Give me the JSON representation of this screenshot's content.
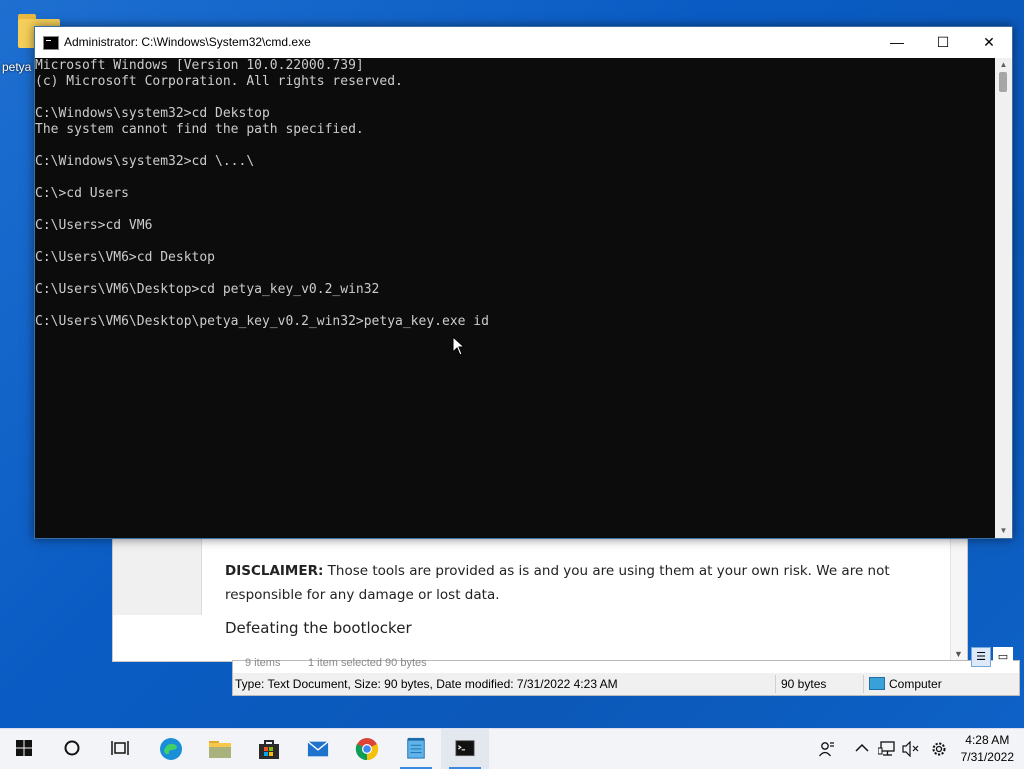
{
  "desktop": {
    "icon_label": "petya"
  },
  "cmd_window": {
    "title": "Administrator: C:\\Windows\\System32\\cmd.exe",
    "minimize": "—",
    "maximize": "☐",
    "close": "✕",
    "lines": [
      "Microsoft Windows [Version 10.0.22000.739]",
      "(c) Microsoft Corporation. All rights reserved.",
      "",
      "C:\\Windows\\system32>cd Dekstop",
      "The system cannot find the path specified.",
      "",
      "C:\\Windows\\system32>cd \\...\\",
      "",
      "C:\\>cd Users",
      "",
      "C:\\Users>cd VM6",
      "",
      "C:\\Users\\VM6>cd Desktop",
      "",
      "C:\\Users\\VM6\\Desktop>cd petya_key_v0.2_win32",
      "",
      "C:\\Users\\VM6\\Desktop\\petya_key_v0.2_win32>petya_key.exe id"
    ]
  },
  "notepad": {
    "disclaimer_bold": "DISCLAIMER:",
    "disclaimer_text": " Those tools are provided as is and you are using them at your own risk. We are not responsible for any damage or lost data.",
    "heading": "Defeating the bootlocker"
  },
  "explorer": {
    "items_partial": "9 items",
    "selected_partial": "1 item selected  90 bytes",
    "status_type": "Type: Text Document, Size: 90 bytes, Date modified: 7/31/2022 4:23 AM",
    "status_size": "90 bytes",
    "status_location": "Computer"
  },
  "taskbar": {
    "apps": [
      {
        "name": "start",
        "icon": "windows-logo"
      },
      {
        "name": "search",
        "icon": "search-circle"
      },
      {
        "name": "task-view",
        "icon": "task-view"
      },
      {
        "name": "edge",
        "icon": "edge"
      },
      {
        "name": "file-explorer",
        "icon": "folder"
      },
      {
        "name": "store",
        "icon": "shopping-bag"
      },
      {
        "name": "mail",
        "icon": "envelope"
      },
      {
        "name": "chrome",
        "icon": "chrome"
      },
      {
        "name": "notepad",
        "icon": "notepad"
      },
      {
        "name": "cmd",
        "icon": "terminal"
      }
    ],
    "time": "4:28 AM",
    "date": "7/31/2022"
  }
}
